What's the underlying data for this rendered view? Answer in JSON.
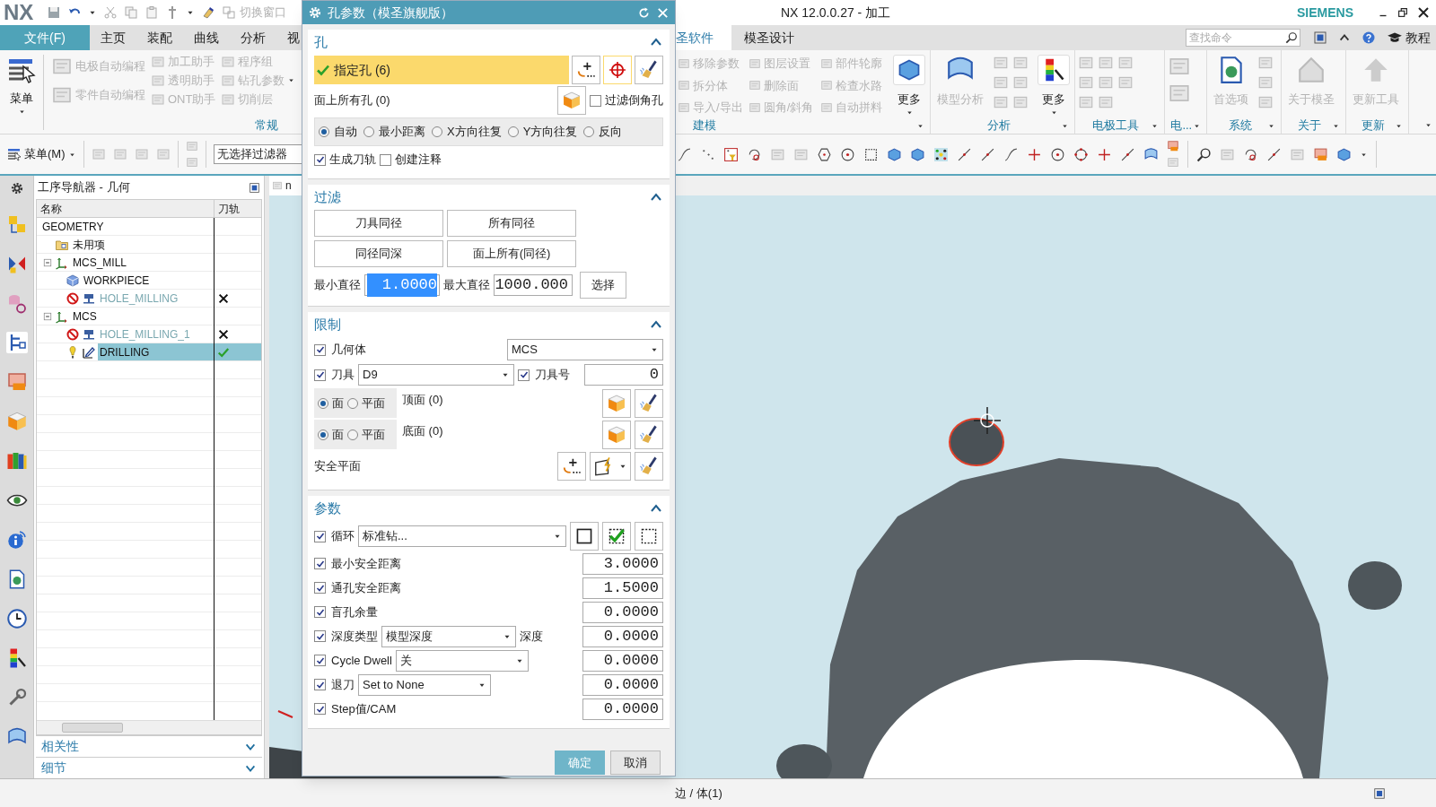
{
  "title_bar": {
    "logo": "NX",
    "switch_window": "切换窗口",
    "title": "NX 12.0.0.27 - 加工",
    "brand": "SIEMENS"
  },
  "tabs_left": [
    {
      "kind": "file",
      "label": "文件(F)"
    },
    {
      "kind": "tab",
      "label": "主页",
      "selected": false
    },
    {
      "kind": "tab",
      "label": "装配",
      "selected": false
    },
    {
      "kind": "tab",
      "label": "曲线",
      "selected": false
    },
    {
      "kind": "tab",
      "label": "分析",
      "selected": false
    },
    {
      "kind": "tab",
      "label": "视",
      "selected": false
    }
  ],
  "tabs_right": [
    {
      "label": "圣软件",
      "selected": true
    },
    {
      "label": "模圣设计",
      "selected": false
    }
  ],
  "search": {
    "placeholder": "查找命令"
  },
  "tutorial": "教程",
  "ribbon_left": {
    "menu_label": "菜单",
    "columns": [
      [
        {
          "label": "电极自动编程",
          "disabled": true,
          "dropdown": false
        },
        {
          "label": "零件自动编程",
          "disabled": true,
          "dropdown": false
        }
      ],
      [
        {
          "label": "加工助手",
          "disabled": true,
          "dropdown": false
        },
        {
          "label": "透明助手",
          "disabled": true,
          "dropdown": false
        },
        {
          "label": "ONT助手",
          "disabled": true,
          "dropdown": false
        }
      ],
      [
        {
          "label": "程序组",
          "disabled": true,
          "dropdown": false
        },
        {
          "label": "钻孔参数",
          "disabled": true,
          "dropdown": true
        },
        {
          "label": "切削层",
          "disabled": true,
          "dropdown": false
        }
      ]
    ],
    "group": "常规"
  },
  "ribbon_right": {
    "groups": [
      {
        "label": "建模",
        "columns": [
          [
            {
              "label": "移除参数",
              "disabled": true
            },
            {
              "label": "拆分体",
              "disabled": true
            },
            {
              "label": "导入/导出",
              "disabled": true
            }
          ],
          [
            {
              "label": "图层设置",
              "disabled": true
            },
            {
              "label": "删除面",
              "disabled": true
            },
            {
              "label": "圆角/斜角",
              "disabled": true
            }
          ],
          [
            {
              "label": "部件轮廓",
              "disabled": true
            },
            {
              "label": "检查水路",
              "disabled": true
            },
            {
              "label": "自动拼料",
              "disabled": true
            }
          ]
        ],
        "more": "更多"
      },
      {
        "label": "分析",
        "big": {
          "label": "模型分析",
          "disabled": true
        },
        "more": "更多"
      },
      {
        "label": "电极工具"
      },
      {
        "label": "电..."
      },
      {
        "label": "系统",
        "big": {
          "label": "首选项",
          "disabled": true
        }
      },
      {
        "label": "关于",
        "big": {
          "label": "关于模圣",
          "disabled": true
        }
      },
      {
        "label": "更新",
        "big": {
          "label": "更新工具",
          "disabled": true
        }
      }
    ]
  },
  "toolbar": {
    "menu": "菜单(M)",
    "filter": "无选择过滤器"
  },
  "navigator": {
    "title": "工序导航器 - 几何",
    "columns": [
      "名称",
      "刀轨"
    ],
    "tree": [
      {
        "name": "GEOMETRY",
        "kind": "root",
        "selected": false,
        "children": [
          {
            "name": "未用项",
            "kind": "folder",
            "selected": false
          },
          {
            "name": "MCS_MILL",
            "kind": "mcs",
            "expanded": true,
            "selected": false,
            "children": [
              {
                "name": "WORKPIECE",
                "kind": "workpiece",
                "selected": false
              },
              {
                "name": "HOLE_MILLING",
                "kind": "operation",
                "suppressed": true,
                "toolpath_generated": false,
                "selected": false
              }
            ]
          },
          {
            "name": "MCS",
            "kind": "mcs",
            "expanded": true,
            "selected": false,
            "children": [
              {
                "name": "HOLE_MILLING_1",
                "kind": "operation",
                "suppressed": true,
                "toolpath_generated": false,
                "selected": false
              },
              {
                "name": "DRILLING",
                "kind": "operation",
                "suppressed": false,
                "toolpath_generated": true,
                "selected": true
              }
            ]
          }
        ]
      }
    ],
    "sections": [
      {
        "label": "相关性",
        "expanded": false
      },
      {
        "label": "细节",
        "expanded": false
      }
    ]
  },
  "viewport": {
    "tab": "n"
  },
  "dialog": {
    "title": "孔参数（模圣旗舰版）",
    "hole_section": {
      "title": "孔",
      "expanded": true,
      "specify": {
        "label": "指定孔 (6)",
        "done": true
      },
      "face_holes": "面上所有孔 (0)",
      "filter_chamfer": {
        "label": "过滤倒角孔",
        "checked": false
      },
      "order": [
        {
          "label": "自动",
          "selected": true
        },
        {
          "label": "最小距离",
          "selected": false
        },
        {
          "label": "X方向往复",
          "selected": false
        },
        {
          "label": "Y方向往复",
          "selected": false
        },
        {
          "label": "反向",
          "selected": false
        }
      ],
      "options": [
        {
          "label": "生成刀轨",
          "checked": true
        },
        {
          "label": "创建注释",
          "checked": false
        }
      ]
    },
    "filter_section": {
      "title": "过滤",
      "expanded": true,
      "buttons": [
        "刀具同径",
        "所有同径",
        "同径同深",
        "面上所有(同径)"
      ],
      "min_label": "最小直径",
      "min_value": {
        "value": "1.0000",
        "highlighted": true
      },
      "max_label": "最大直径",
      "max_value": "1000.000",
      "select": "选择"
    },
    "limits_section": {
      "title": "限制",
      "expanded": true,
      "geometry": {
        "label": "几何体",
        "checked": true,
        "value": "MCS"
      },
      "tool": {
        "label": "刀具",
        "checked": true,
        "value": "D9"
      },
      "tool_number": {
        "label": "刀具号",
        "checked": true,
        "value": "0"
      },
      "faces": [
        {
          "options": [
            {
              "label": "面",
              "selected": true
            },
            {
              "label": "平面",
              "selected": false
            }
          ],
          "label": "顶面 (0)"
        },
        {
          "options": [
            {
              "label": "面",
              "selected": true
            },
            {
              "label": "平面",
              "selected": false
            }
          ],
          "label": "底面 (0)"
        }
      ],
      "safe_plane": "安全平面"
    },
    "params_section": {
      "title": "参数",
      "expanded": true,
      "rows": [
        {
          "kind": "cycle",
          "label": "循环",
          "checked": true,
          "select": "标准钻..."
        },
        {
          "kind": "value",
          "label": "最小安全距离",
          "checked": true,
          "value": "3.0000"
        },
        {
          "kind": "value",
          "label": "通孔安全距离",
          "checked": true,
          "value": "1.5000"
        },
        {
          "kind": "value",
          "label": "盲孔余量",
          "checked": true,
          "value": "0.0000"
        },
        {
          "kind": "select_value",
          "label": "深度类型",
          "checked": true,
          "select": "模型深度",
          "select_label": "深度",
          "value": "0.0000"
        },
        {
          "kind": "select_value",
          "label": "Cycle Dwell",
          "checked": true,
          "select": "关",
          "value": "0.0000"
        },
        {
          "kind": "select_value",
          "label": "退刀",
          "checked": true,
          "select": "Set to None",
          "value": "0.0000"
        },
        {
          "kind": "value",
          "label": "Step值/CAM",
          "checked": true,
          "value": "0.0000"
        }
      ]
    },
    "buttons": [
      {
        "label": "确定",
        "kind": "primary"
      },
      {
        "label": "取消",
        "kind": "secondary"
      }
    ]
  },
  "status_bar": {
    "text": "边 / 体(1)"
  }
}
